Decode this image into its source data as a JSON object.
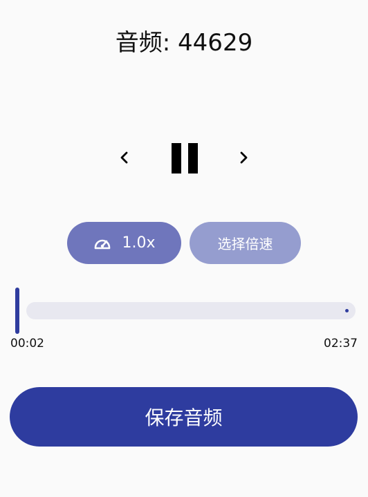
{
  "header": {
    "title": "音频: 44629"
  },
  "transport": {
    "prev_icon": "chevron-left-icon",
    "pause_icon": "pause-icon",
    "next_icon": "chevron-right-icon"
  },
  "speed": {
    "current_label": "1.0x",
    "icon": "speedometer-icon",
    "choose_label": "选择倍速",
    "colors": {
      "speed_bg": "#6f76bc",
      "choose_bg": "#959dcf"
    }
  },
  "seek": {
    "progress": 0.013,
    "current_time": "00:02",
    "total_time": "02:37"
  },
  "actions": {
    "save_label": "保存音频",
    "save_color": "#2e3c9f"
  }
}
